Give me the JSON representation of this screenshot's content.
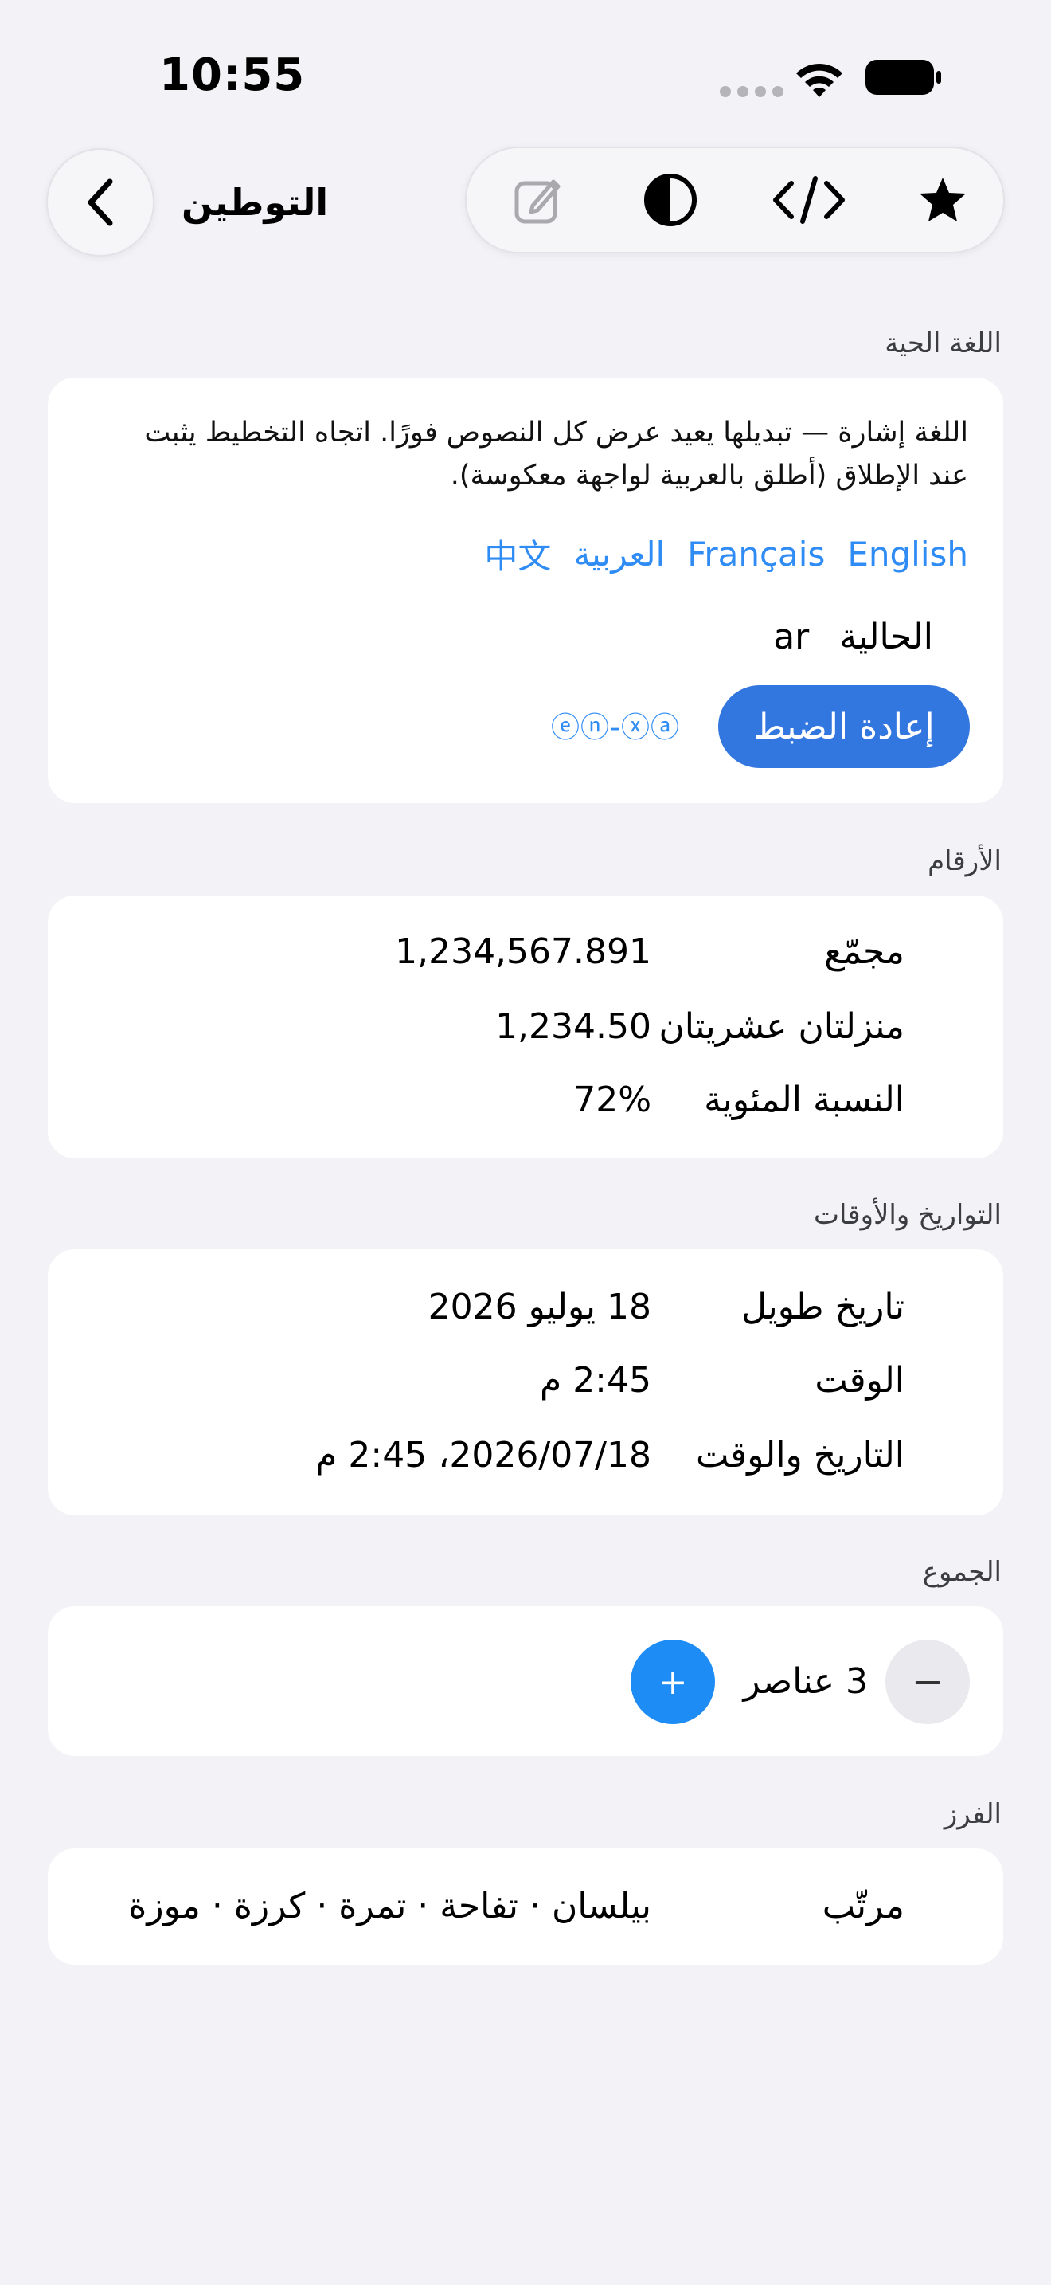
{
  "status": {
    "time": "10:55"
  },
  "nav": {
    "title": "التوطين"
  },
  "sections": {
    "live_language": {
      "header": "اللغة الحية",
      "description": "اللغة إشارة — تبديلها يعيد عرض كل النصوص فورًا. اتجاه التخطيط يثبت عند الإطلاق (أطلق بالعربية لواجهة معكوسة).",
      "languages": [
        "English",
        "Français",
        "العربية",
        "中文"
      ],
      "current_label": "الحالية",
      "current_value": "ar",
      "reset_label": "إعادة الضبط",
      "pseudo_locale": "ⓔⓝ-ⓧⓐ"
    },
    "numbers": {
      "header": "الأرقام",
      "rows": [
        {
          "label": "مجمّع",
          "value": "1,234,567.891"
        },
        {
          "label": "منزلتان عشريتان",
          "value": "1,234.50"
        },
        {
          "label": "النسبة المئوية",
          "value": "72%"
        }
      ]
    },
    "dates": {
      "header": "التواريخ والأوقات",
      "rows": [
        {
          "label": "تاريخ طويل",
          "value": "18 يوليو 2026"
        },
        {
          "label": "الوقت",
          "value": "2:45 م"
        },
        {
          "label": "التاريخ والوقت",
          "value": "2026/07/18، 2:45 م"
        }
      ]
    },
    "plural": {
      "header": "الجموع",
      "count_label": "3 عناصر",
      "minus_label": "−",
      "plus_label": "+"
    },
    "sorting": {
      "header": "الفرز",
      "label": "مرتّب",
      "value": "بيلسان · تفاحة · تمرة · كرزة · موزة"
    }
  },
  "colors": {
    "accent": "#2F8CF5",
    "reset_button": "#3277E0",
    "background": "#F2F2F7"
  }
}
